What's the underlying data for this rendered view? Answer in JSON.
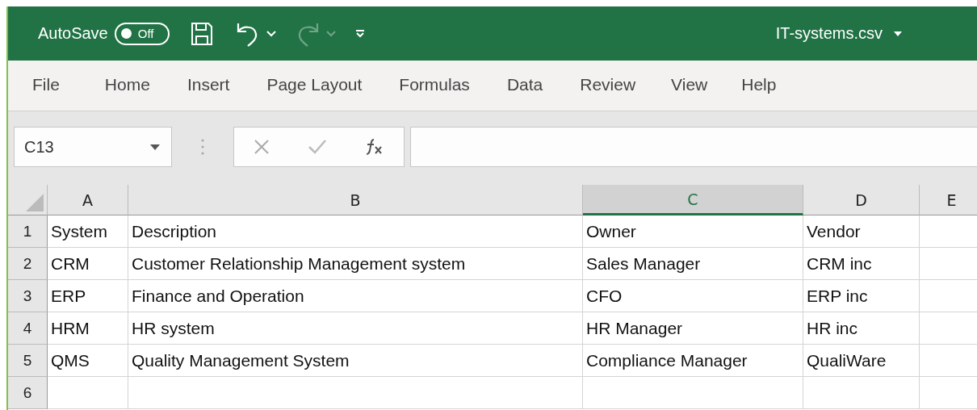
{
  "title_bar": {
    "autosave_label": "AutoSave",
    "autosave": {
      "on": false,
      "label": "Off"
    },
    "redo_disabled": true,
    "file_name": "IT-systems.csv"
  },
  "ribbon_tabs": [
    {
      "label": "File",
      "selected": false
    },
    {
      "label": "Home",
      "selected": false
    },
    {
      "label": "Insert",
      "selected": false
    },
    {
      "label": "Page Layout",
      "selected": false
    },
    {
      "label": "Formulas",
      "selected": false
    },
    {
      "label": "Data",
      "selected": false
    },
    {
      "label": "Review",
      "selected": false
    },
    {
      "label": "View",
      "selected": false
    },
    {
      "label": "Help",
      "selected": false
    }
  ],
  "formula_bar": {
    "name_box": "C13"
  },
  "sheet": {
    "columns": [
      {
        "label": "A",
        "selected": false
      },
      {
        "label": "B",
        "selected": false
      },
      {
        "label": "C",
        "selected": true
      },
      {
        "label": "D",
        "selected": false
      },
      {
        "label": "E",
        "selected": false
      }
    ],
    "rows": [
      {
        "number": "1",
        "cells": [
          "System",
          "Description",
          "Owner",
          "Vendor",
          ""
        ]
      },
      {
        "number": "2",
        "cells": [
          "CRM",
          "Customer Relationship Management system",
          "Sales Manager",
          "CRM inc",
          ""
        ]
      },
      {
        "number": "3",
        "cells": [
          "ERP",
          "Finance and Operation",
          "CFO",
          "ERP inc",
          ""
        ]
      },
      {
        "number": "4",
        "cells": [
          "HRM",
          "HR system",
          "HR Manager",
          "HR inc",
          ""
        ]
      },
      {
        "number": "5",
        "cells": [
          "QMS",
          "Quality Management System",
          "Compliance Manager",
          "QualiWare",
          ""
        ]
      },
      {
        "number": "6",
        "cells": [
          "",
          "",
          "",
          "",
          ""
        ]
      }
    ]
  }
}
